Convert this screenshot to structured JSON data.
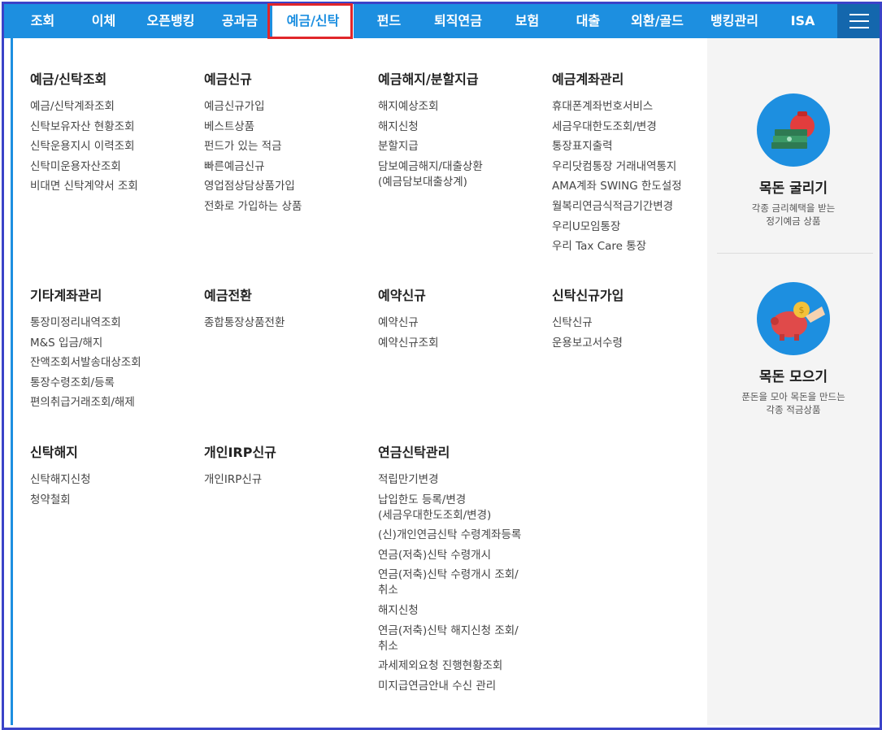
{
  "nav": {
    "items": [
      {
        "label": "조회"
      },
      {
        "label": "이체"
      },
      {
        "label": "오픈뱅킹"
      },
      {
        "label": "공과금"
      },
      {
        "label": "예금/신탁"
      },
      {
        "label": "펀드"
      },
      {
        "label": "퇴직연금"
      },
      {
        "label": "보험"
      },
      {
        "label": "대출"
      },
      {
        "label": "외환/골드"
      },
      {
        "label": "뱅킹관리"
      },
      {
        "label": "ISA"
      }
    ],
    "active": "예금/신탁",
    "menu_icon": "hamburger-icon"
  },
  "sections": [
    {
      "title": "예금/신탁조회",
      "links": [
        "예금/신탁계좌조회",
        "신탁보유자산 현황조회",
        "신탁운용지시 이력조회",
        "신탁미운용자산조회",
        "비대면 신탁계약서 조회"
      ]
    },
    {
      "title": "예금신규",
      "links": [
        "예금신규가입",
        "베스트상품",
        "펀드가 있는 적금",
        "빠른예금신규",
        "영업점상담상품가입",
        "전화로 가입하는 상품"
      ]
    },
    {
      "title": "예금해지/분할지급",
      "links": [
        "해지예상조회",
        "해지신청",
        "분할지급",
        "담보예금해지/대출상환",
        "(예금담보대출상계)"
      ]
    },
    {
      "title": "예금계좌관리",
      "links": [
        "휴대폰계좌번호서비스",
        "세금우대한도조회/변경",
        "통장표지출력",
        "우리닷컴통장 거래내역통지",
        "AMA계좌 SWING 한도설정",
        "월복리연금식적금기간변경",
        "우리U모임통장",
        "우리 Tax Care 통장"
      ]
    },
    {
      "title": "기타계좌관리",
      "links": [
        "통장미정리내역조회",
        "M&S 입금/해지",
        "잔액조회서발송대상조회",
        "통장수령조회/등록",
        "편의취급거래조회/해제"
      ]
    },
    {
      "title": "예금전환",
      "links": [
        "종합통장상품전환"
      ]
    },
    {
      "title": "예약신규",
      "links": [
        "예약신규",
        "예약신규조회"
      ]
    },
    {
      "title": "신탁신규가입",
      "links": [
        "신탁신규",
        "운용보고서수령"
      ]
    },
    {
      "title": "신탁해지",
      "links": [
        "신탁해지신청",
        "청약철회"
      ]
    },
    {
      "title": "개인IRP신규",
      "links": [
        "개인IRP신규"
      ]
    },
    {
      "title": "연금신탁관리",
      "links": [
        "적립만기변경",
        "납입한도 등록/변경",
        "(세금우대한도조회/변경)",
        "(신)개인연금신탁 수령계좌등록",
        "연금(저축)신탁 수령개시",
        "연금(저축)신탁 수령개시 조회/취소",
        "해지신청",
        "연금(저축)신탁 해지신청 조회/취소",
        "과세제외요청 진행현황조회",
        "미지급연금안내 수신 관리"
      ]
    }
  ],
  "promos": [
    {
      "title": "목돈 굴리기",
      "desc1": "각종 금리혜택을 받는",
      "desc2": "정기예금 상품",
      "icon": "money-bag-icon"
    },
    {
      "title": "목돈 모으기",
      "desc1": "푼돈을 모아 목돈을 만드는",
      "desc2": "각종 적금상품",
      "icon": "piggy-bank-icon"
    }
  ],
  "colors": {
    "nav_bg": "#1d8fe0",
    "nav_dark": "#1467ad",
    "active_outline": "#e0262a",
    "frame": "#3b43c8",
    "panel_bg": "#f4f4f4"
  }
}
